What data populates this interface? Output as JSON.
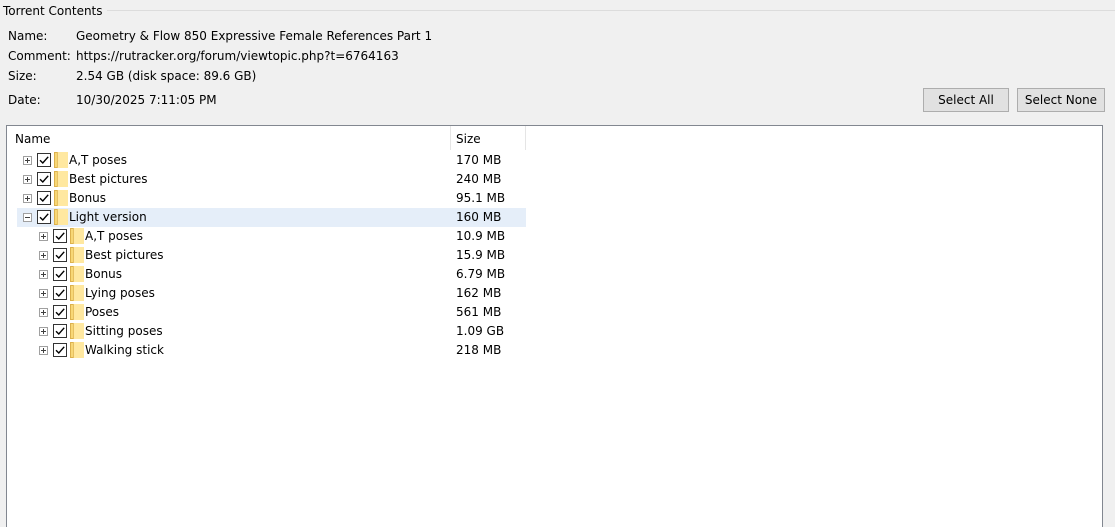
{
  "group_title": "Torrent Contents",
  "info": {
    "name_label": "Name:",
    "name_value": "Geometry & Flow 850 Expressive Female References Part 1",
    "comment_label": "Comment:",
    "comment_value": "https://rutracker.org/forum/viewtopic.php?t=6764163",
    "size_label": "Size:",
    "size_value": "2.54 GB (disk space: 89.6 GB)",
    "date_label": "Date:",
    "date_value": "10/30/2025 7:11:05 PM"
  },
  "buttons": {
    "select_all": "Select All",
    "select_none": "Select None"
  },
  "tree": {
    "columns": {
      "name": "Name",
      "size": "Size"
    },
    "rows": [
      {
        "name": "A,T poses",
        "size": "170 MB",
        "level": 0,
        "expanded": false,
        "checked": true,
        "selected": false
      },
      {
        "name": "Best pictures",
        "size": "240 MB",
        "level": 0,
        "expanded": false,
        "checked": true,
        "selected": false
      },
      {
        "name": "Bonus",
        "size": "95.1 MB",
        "level": 0,
        "expanded": false,
        "checked": true,
        "selected": false
      },
      {
        "name": "Light version",
        "size": "160 MB",
        "level": 0,
        "expanded": true,
        "checked": true,
        "selected": true
      },
      {
        "name": "A,T poses",
        "size": "10.9 MB",
        "level": 1,
        "expanded": false,
        "checked": true,
        "selected": false
      },
      {
        "name": "Best pictures",
        "size": "15.9 MB",
        "level": 1,
        "expanded": false,
        "checked": true,
        "selected": false
      },
      {
        "name": "Bonus",
        "size": "6.79 MB",
        "level": 1,
        "expanded": false,
        "checked": true,
        "selected": false
      },
      {
        "name": "Lying poses",
        "size": "162 MB",
        "level": 1,
        "expanded": false,
        "checked": true,
        "selected": false
      },
      {
        "name": "Poses",
        "size": "561 MB",
        "level": 1,
        "expanded": false,
        "checked": true,
        "selected": false
      },
      {
        "name": "Sitting poses",
        "size": "1.09 GB",
        "level": 1,
        "expanded": false,
        "checked": true,
        "selected": false
      },
      {
        "name": "Walking stick",
        "size": "218 MB",
        "level": 1,
        "expanded": false,
        "checked": true,
        "selected": false
      }
    ]
  },
  "icons": {
    "folder": "folder-icon",
    "expander_plus": "plus-box-icon",
    "expander_minus": "minus-box-icon",
    "checkbox": "checkbox-checked-icon"
  },
  "colors": {
    "selected_row": "#e5eef9",
    "folder": "#f8d775"
  }
}
